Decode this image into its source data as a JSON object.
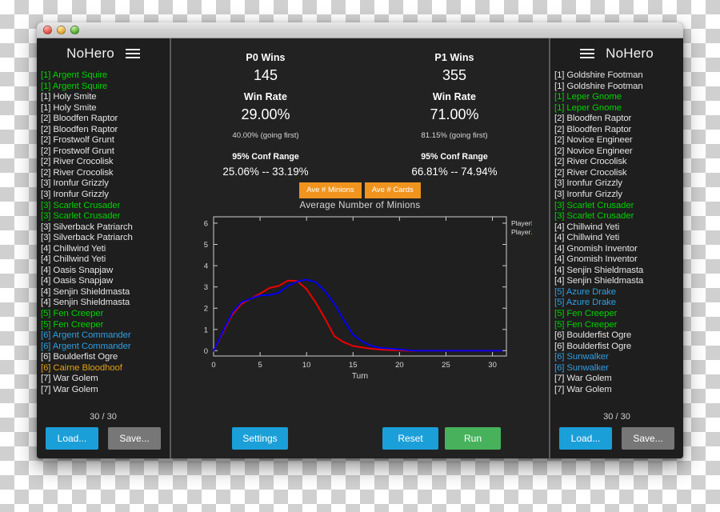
{
  "window": {
    "traffic_lights": [
      "close",
      "minimize",
      "zoom"
    ]
  },
  "left_panel": {
    "title": "NoHero",
    "menu_icon": "hamburger-icon",
    "count": "30 / 30",
    "load_label": "Load...",
    "save_label": "Save...",
    "cards": [
      {
        "text": "[1] Argent Squire",
        "rarity": "epic"
      },
      {
        "text": "[1] Argent Squire",
        "rarity": "epic"
      },
      {
        "text": "[1] Holy Smite",
        "rarity": "common"
      },
      {
        "text": "[1] Holy Smite",
        "rarity": "common"
      },
      {
        "text": "[2] Bloodfen Raptor",
        "rarity": "common"
      },
      {
        "text": "[2] Bloodfen Raptor",
        "rarity": "common"
      },
      {
        "text": "[2] Frostwolf Grunt",
        "rarity": "common"
      },
      {
        "text": "[2] Frostwolf Grunt",
        "rarity": "common"
      },
      {
        "text": "[2] River Crocolisk",
        "rarity": "common"
      },
      {
        "text": "[2] River Crocolisk",
        "rarity": "common"
      },
      {
        "text": "[3] Ironfur Grizzly",
        "rarity": "common"
      },
      {
        "text": "[3] Ironfur Grizzly",
        "rarity": "common"
      },
      {
        "text": "[3] Scarlet Crusader",
        "rarity": "epic"
      },
      {
        "text": "[3] Scarlet Crusader",
        "rarity": "epic"
      },
      {
        "text": "[3] Silverback Patriarch",
        "rarity": "common"
      },
      {
        "text": "[3] Silverback Patriarch",
        "rarity": "common"
      },
      {
        "text": "[4] Chillwind Yeti",
        "rarity": "common"
      },
      {
        "text": "[4] Chillwind Yeti",
        "rarity": "common"
      },
      {
        "text": "[4] Oasis Snapjaw",
        "rarity": "common"
      },
      {
        "text": "[4] Oasis Snapjaw",
        "rarity": "common"
      },
      {
        "text": "[4] Senjin Shieldmasta",
        "rarity": "common"
      },
      {
        "text": "[4] Senjin Shieldmasta",
        "rarity": "common"
      },
      {
        "text": "[5] Fen Creeper",
        "rarity": "epic"
      },
      {
        "text": "[5] Fen Creeper",
        "rarity": "epic"
      },
      {
        "text": "[6] Argent Commander",
        "rarity": "rare"
      },
      {
        "text": "[6] Argent Commander",
        "rarity": "rare"
      },
      {
        "text": "[6] Boulderfist Ogre",
        "rarity": "common"
      },
      {
        "text": "[6] Cairne Bloodhoof",
        "rarity": "legendary"
      },
      {
        "text": "[7] War Golem",
        "rarity": "common"
      },
      {
        "text": "[7] War Golem",
        "rarity": "common"
      }
    ]
  },
  "right_panel": {
    "title": "NoHero",
    "menu_icon": "hamburger-icon",
    "count": "30 / 30",
    "load_label": "Load...",
    "save_label": "Save...",
    "cards": [
      {
        "text": "[1] Goldshire Footman",
        "rarity": "common"
      },
      {
        "text": "[1] Goldshire Footman",
        "rarity": "common"
      },
      {
        "text": "[1] Leper Gnome",
        "rarity": "epic"
      },
      {
        "text": "[1] Leper Gnome",
        "rarity": "epic"
      },
      {
        "text": "[2] Bloodfen Raptor",
        "rarity": "common"
      },
      {
        "text": "[2] Bloodfen Raptor",
        "rarity": "common"
      },
      {
        "text": "[2] Novice Engineer",
        "rarity": "common"
      },
      {
        "text": "[2] Novice Engineer",
        "rarity": "common"
      },
      {
        "text": "[2] River Crocolisk",
        "rarity": "common"
      },
      {
        "text": "[2] River Crocolisk",
        "rarity": "common"
      },
      {
        "text": "[3] Ironfur Grizzly",
        "rarity": "common"
      },
      {
        "text": "[3] Ironfur Grizzly",
        "rarity": "common"
      },
      {
        "text": "[3] Scarlet Crusader",
        "rarity": "epic"
      },
      {
        "text": "[3] Scarlet Crusader",
        "rarity": "epic"
      },
      {
        "text": "[4] Chillwind Yeti",
        "rarity": "common"
      },
      {
        "text": "[4] Chillwind Yeti",
        "rarity": "common"
      },
      {
        "text": "[4] Gnomish Inventor",
        "rarity": "common"
      },
      {
        "text": "[4] Gnomish Inventor",
        "rarity": "common"
      },
      {
        "text": "[4] Senjin Shieldmasta",
        "rarity": "common"
      },
      {
        "text": "[4] Senjin Shieldmasta",
        "rarity": "common"
      },
      {
        "text": "[5] Azure Drake",
        "rarity": "rare"
      },
      {
        "text": "[5] Azure Drake",
        "rarity": "rare"
      },
      {
        "text": "[5] Fen Creeper",
        "rarity": "epic"
      },
      {
        "text": "[5] Fen Creeper",
        "rarity": "epic"
      },
      {
        "text": "[6] Boulderfist Ogre",
        "rarity": "common"
      },
      {
        "text": "[6] Boulderfist Ogre",
        "rarity": "common"
      },
      {
        "text": "[6] Sunwalker",
        "rarity": "rare"
      },
      {
        "text": "[6] Sunwalker",
        "rarity": "rare"
      },
      {
        "text": "[7] War Golem",
        "rarity": "common"
      },
      {
        "text": "[7] War Golem",
        "rarity": "common"
      }
    ]
  },
  "stats": {
    "p0": {
      "wins_label": "P0 Wins",
      "wins_value": "145",
      "win_rate_label": "Win Rate",
      "win_rate_value": "29.00%",
      "going_first": "40.00% (going first)",
      "conf_label": "95% Conf Range",
      "conf_value": "25.06% -- 33.19%"
    },
    "p1": {
      "wins_label": "P1 Wins",
      "wins_value": "355",
      "win_rate_label": "Win Rate",
      "win_rate_value": "71.00%",
      "going_first": "81.15% (going first)",
      "conf_label": "95% Conf Range",
      "conf_value": "66.81% -- 74.94%"
    }
  },
  "chart_tabs": [
    {
      "label": "Ave # Minions",
      "active": true
    },
    {
      "label": "Ave # Cards",
      "active": false
    }
  ],
  "bottom_buttons": {
    "settings": "Settings",
    "reset": "Reset",
    "run": "Run"
  },
  "colors": {
    "accent_blue": "#1b9fd8",
    "accent_green": "#47b25b",
    "accent_orange": "#f0941e",
    "player0": "#ee0000",
    "player1": "#0000ee",
    "rarity_common": "#e4e4e4",
    "rarity_rare": "#2f9ee0",
    "rarity_epic": "#00d200",
    "rarity_legendary": "#e0a011"
  },
  "chart_data": {
    "type": "line",
    "title": "Average Number of Minions",
    "xlabel": "Turn",
    "ylabel": "",
    "xlim": [
      0,
      31.5
    ],
    "ylim": [
      -0.25,
      6.3
    ],
    "xticks": [
      0,
      5,
      10,
      15,
      20,
      25,
      30
    ],
    "yticks": [
      0,
      1,
      2,
      3,
      4,
      5,
      6
    ],
    "grid": false,
    "legend_position": "right-top",
    "x": [
      0,
      1,
      2,
      3,
      4,
      5,
      6,
      7,
      8,
      9,
      10,
      11,
      12,
      13,
      14,
      15,
      16,
      17,
      18,
      19,
      20,
      21,
      22,
      23,
      24,
      25,
      26,
      27,
      28,
      29,
      30,
      31
    ],
    "series": [
      {
        "name": "Player0",
        "color": "#ee0000",
        "values": [
          0.0,
          0.85,
          1.7,
          2.2,
          2.45,
          2.68,
          2.95,
          3.05,
          3.3,
          3.28,
          2.9,
          2.25,
          1.5,
          0.68,
          0.4,
          0.22,
          0.15,
          0.09,
          0.05,
          0.03,
          0.02,
          0.0,
          0.0,
          0.0,
          0.0,
          0.0,
          0.0,
          0.0,
          0.0,
          0.0,
          0.0,
          0.0
        ]
      },
      {
        "name": "Player1",
        "color": "#0000ee",
        "values": [
          0.0,
          0.9,
          1.78,
          2.28,
          2.45,
          2.6,
          2.62,
          2.72,
          3.05,
          3.25,
          3.35,
          3.22,
          2.8,
          2.2,
          1.45,
          0.75,
          0.42,
          0.22,
          0.13,
          0.1,
          0.06,
          0.02,
          0.0,
          0.0,
          0.0,
          0.0,
          0.0,
          0.0,
          0.0,
          0.0,
          0.0,
          0.0
        ]
      }
    ]
  }
}
